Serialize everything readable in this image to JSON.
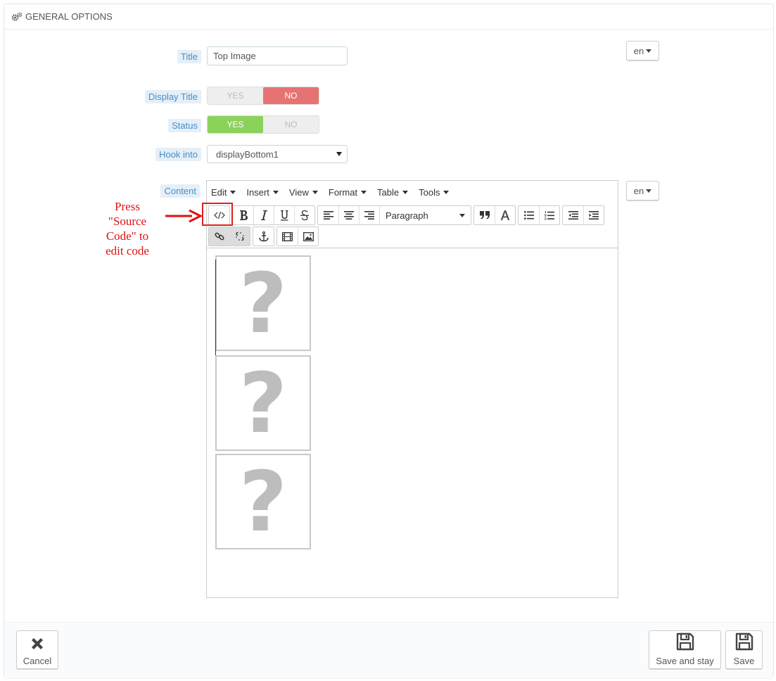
{
  "panel": {
    "heading": "GENERAL OPTIONS",
    "heading_icon": "cogs-icon"
  },
  "form": {
    "title_label": "Title",
    "title_value": "Top Image",
    "language": "en",
    "display_title_label": "Display Title",
    "display_title": {
      "yes": "YES",
      "no": "NO",
      "selected": "NO"
    },
    "status_label": "Status",
    "status": {
      "yes": "YES",
      "no": "NO",
      "selected": "YES"
    },
    "hook_label": "Hook into",
    "hook_value": "displayBottom1",
    "content_label": "Content",
    "content_language": "en"
  },
  "editor": {
    "menus": [
      "Edit",
      "Insert",
      "View",
      "Format",
      "Table",
      "Tools"
    ],
    "block_format": "Paragraph",
    "image_placeholder_glyph": "?"
  },
  "annotation": {
    "lines": [
      "Press",
      "\"Source",
      "Code\" to",
      "edit code"
    ],
    "color": "#e01010"
  },
  "footer": {
    "cancel_label": "Cancel",
    "save_and_stay_label": "Save and stay",
    "save_label": "Save"
  },
  "colors": {
    "label_text": "#4a8ec4",
    "label_bg": "#e4eff8",
    "switch_no": "#e57373",
    "switch_yes": "#8bd25a"
  }
}
